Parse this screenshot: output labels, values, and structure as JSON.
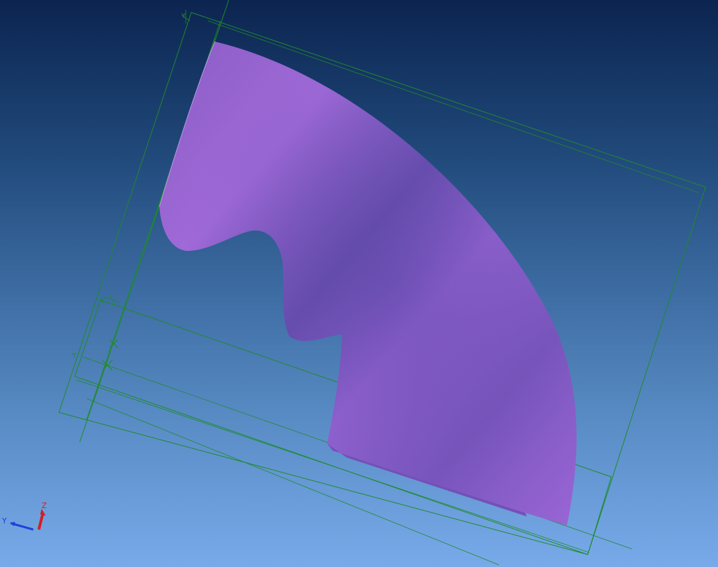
{
  "viewport": {
    "background_top": "#0c2450",
    "background_bottom": "#78aaea"
  },
  "model": {
    "surface_color": "#9a66d6",
    "surface_shadow": "#6a4fb0",
    "wireframe_color": "#1f8a2a"
  },
  "datum_planes": [
    {
      "label": "Y"
    },
    {
      "label": "Y"
    },
    {
      "label": "Y"
    }
  ],
  "triad": {
    "x_color": "#d32020",
    "y_color": "#2040d8",
    "z_color": "#d32020",
    "y_label": "Y",
    "z_label": "Z"
  }
}
